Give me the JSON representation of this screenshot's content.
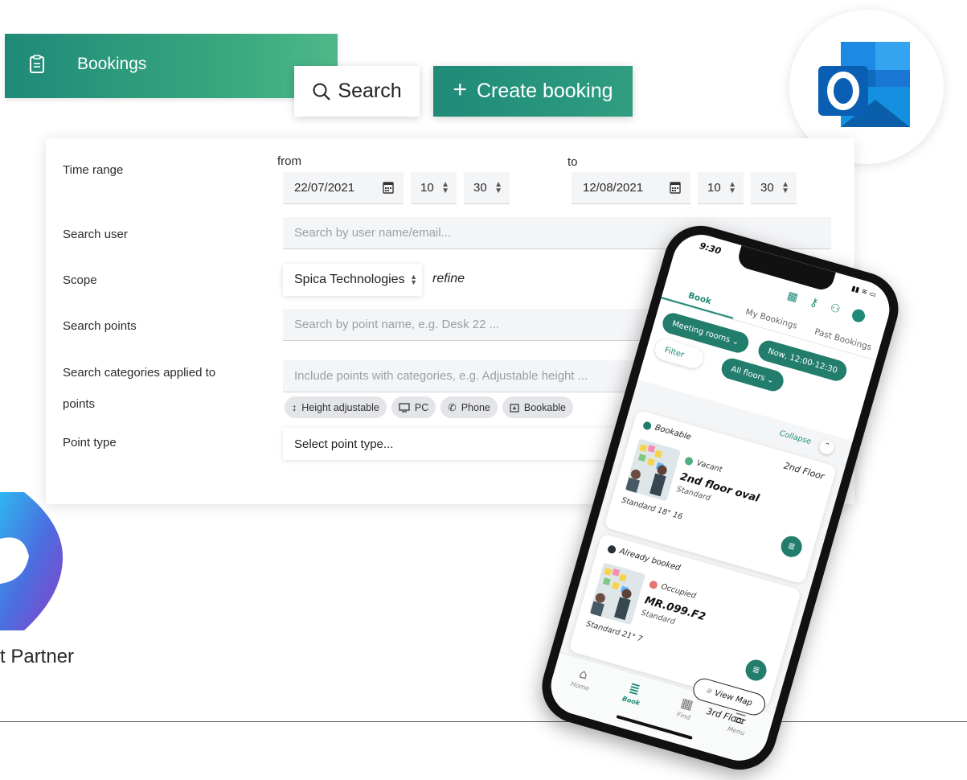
{
  "header": {
    "title": "Bookings",
    "search_label": "Search",
    "create_label": "Create booking"
  },
  "form": {
    "time_range_label": "Time range",
    "from_label": "from",
    "to_label": "to",
    "from_date": "22/07/2021",
    "from_hour": "10",
    "from_minute": "30",
    "to_date": "12/08/2021",
    "to_hour": "10",
    "to_minute": "30",
    "search_user_label": "Search user",
    "search_user_placeholder": "Search by user name/email...",
    "scope_label": "Scope",
    "scope_value": "Spica Technologies",
    "refine_label": "refine",
    "search_points_label": "Search points",
    "search_points_placeholder": "Search by point name, e.g. Desk 22 ...",
    "categories_label_1": "Search categories applied to",
    "categories_label_2": "points",
    "categories_placeholder": "Include points with categories, e.g. Adjustable height ...",
    "chips": [
      "Height adjustable",
      "PC",
      "Phone",
      "Bookable"
    ],
    "point_type_label": "Point type",
    "point_type_placeholder": "Select point type..."
  },
  "partner": {
    "text": "t Partner"
  },
  "phone": {
    "time": "9:30",
    "tabs": [
      "Book",
      "My Bookings",
      "Past Bookings"
    ],
    "filters": {
      "meeting_rooms": "Meeting rooms",
      "now": "Now, 12:00-12:30",
      "filter": "Filter",
      "all_floors": "All floors"
    },
    "collapse": "Collapse",
    "cards": [
      {
        "status": "Bookable",
        "floor": "2nd Floor",
        "availability": "Vacant",
        "name": "2nd floor oval",
        "type": "Standard",
        "meta": "Standard  18°  16"
      },
      {
        "status": "Already booked",
        "floor": "",
        "availability": "Occupied",
        "name": "MR.099.F2",
        "type": "Standard",
        "meta": "Standard  21°  7"
      }
    ],
    "view_map": "View Map",
    "third_floor": "3rd Floor",
    "nav": [
      "Home",
      "Book",
      "Find",
      "Menu"
    ]
  },
  "colors": {
    "brand_green": "#1f8a78",
    "outlook_blue": "#0f6cbd",
    "vacant": "#4caf7d",
    "occupied": "#e57373"
  }
}
